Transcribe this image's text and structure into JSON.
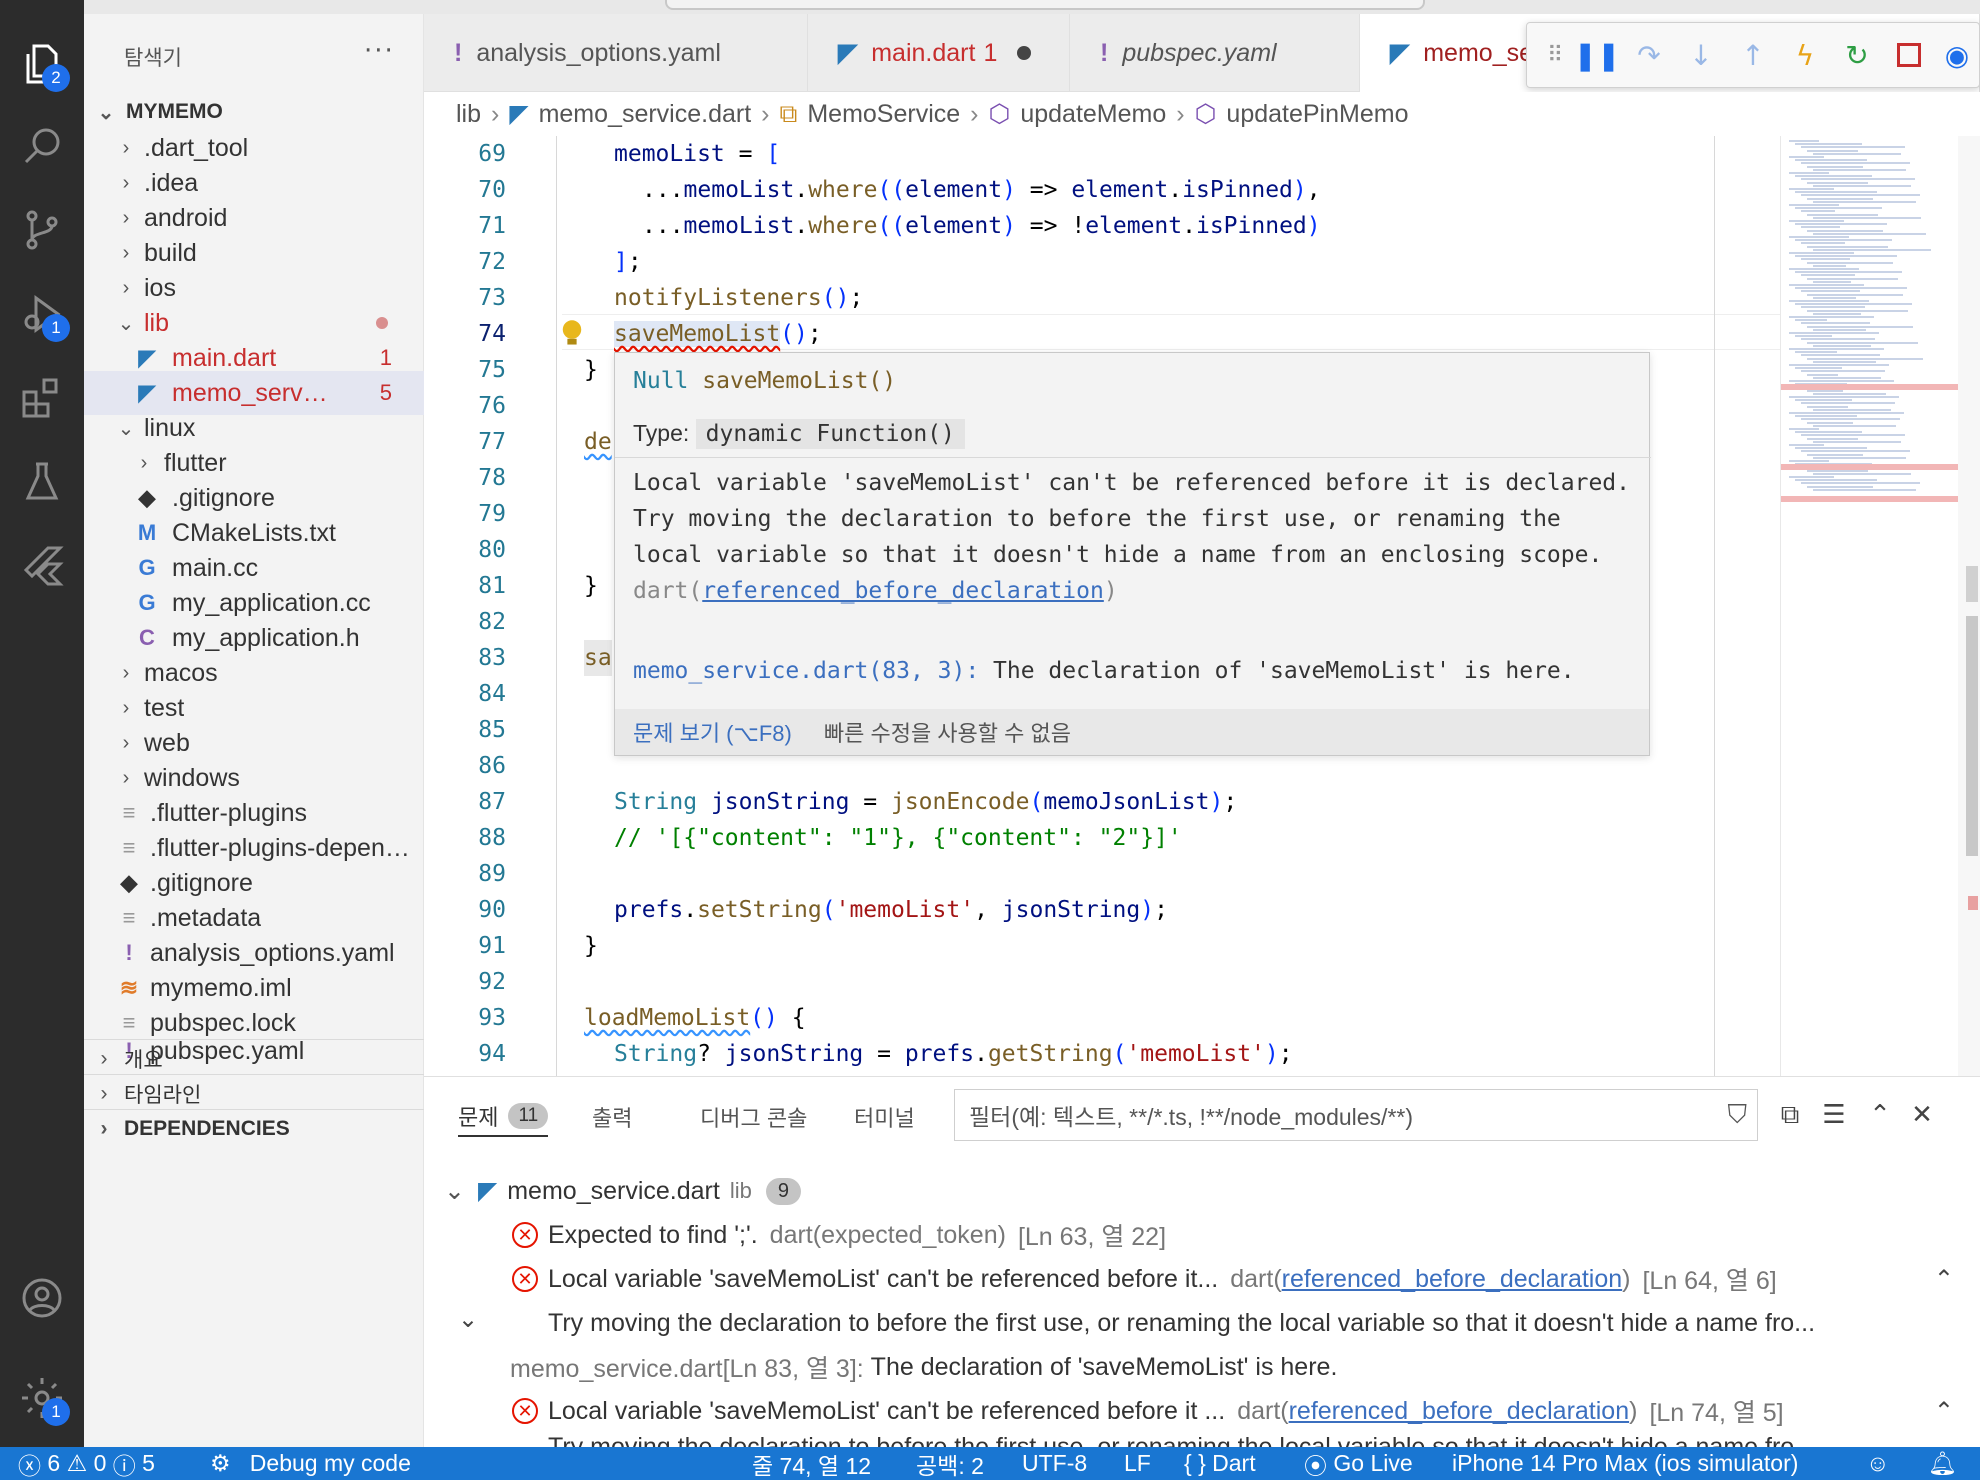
{
  "activity_bar": {
    "explorer_badge": "2",
    "debug_badge": "1",
    "settings_badge": "1"
  },
  "sidebar": {
    "title": "탐색기",
    "more": "···",
    "root": "MYMEMO",
    "items": [
      {
        "label": ".dart_tool"
      },
      {
        "label": ".idea"
      },
      {
        "label": "android"
      },
      {
        "label": "build"
      },
      {
        "label": "ios"
      },
      {
        "label": "lib"
      },
      {
        "label": "main.dart",
        "count": "1"
      },
      {
        "label": "memo_service.dart",
        "count": "5"
      },
      {
        "label": "linux"
      },
      {
        "label": "flutter"
      },
      {
        "label": ".gitignore"
      },
      {
        "label": "CMakeLists.txt"
      },
      {
        "label": "main.cc"
      },
      {
        "label": "my_application.cc"
      },
      {
        "label": "my_application.h"
      },
      {
        "label": "macos"
      },
      {
        "label": "test"
      },
      {
        "label": "web"
      },
      {
        "label": "windows"
      },
      {
        "label": ".flutter-plugins"
      },
      {
        "label": ".flutter-plugins-dependencies"
      },
      {
        "label": ".gitignore"
      },
      {
        "label": ".metadata"
      },
      {
        "label": "analysis_options.yaml"
      },
      {
        "label": "mymemo.iml"
      },
      {
        "label": "pubspec.lock"
      },
      {
        "label": "pubspec.yaml"
      }
    ],
    "sections": [
      {
        "label": "개요"
      },
      {
        "label": "타임라인"
      },
      {
        "label": "DEPENDENCIES"
      }
    ]
  },
  "tabs": [
    {
      "label": "analysis_options.yaml"
    },
    {
      "label": "main.dart",
      "badge": "1"
    },
    {
      "label": "pubspec.yaml"
    },
    {
      "label": "memo_service.dart"
    }
  ],
  "breadcrumb": [
    "lib",
    "memo_service.dart",
    "MemoService",
    "updateMemo",
    "updatePinMemo"
  ],
  "editor": {
    "line_numbers": [
      "69",
      "70",
      "71",
      "72",
      "73",
      "74",
      "75",
      "76",
      "77",
      "78",
      "79",
      "80",
      "81",
      "82",
      "83",
      "84",
      "85",
      "86",
      "87",
      "88",
      "89",
      "90",
      "91",
      "92",
      "93",
      "94"
    ],
    "current_line": "74",
    "tokens": {
      "memoList": "memoList",
      "where": "where",
      "element": "element",
      "isPinned": "isPinned",
      "notifyListeners": "notifyListeners",
      "saveMemoList": "saveMemoList",
      "String": "String",
      "jsonString": "jsonString",
      "jsonEncode": "jsonEncode",
      "memoJsonList": "memoJsonList",
      "comment88": "// '[{\"content\": \"1\"}, {\"content\": \"2\"}]'",
      "prefs": "prefs",
      "setString": "setString",
      "str_memoList": "'memoList'",
      "loadMemoList": "loadMemoList",
      "getString": "getString",
      "de": "de",
      "sa": "sa"
    }
  },
  "hover": {
    "signature_type": "Null",
    "signature_name": "saveMemoList()",
    "type_label": "Type:",
    "type_value": "dynamic Function()",
    "message": "Local variable 'saveMemoList' can't be referenced before it is declared.\nTry moving the declaration to before the first use, or renaming the local variable so that it doesn't hide a name from an enclosing scope.",
    "source_prefix": "dart(",
    "source_code": "referenced_before_declaration",
    "source_suffix": ")",
    "related_loc": "memo_service.dart(83, 3):",
    "related_msg": "The declaration of 'saveMemoList' is here.",
    "action_view": "문제 보기 (⌥F8)",
    "action_fix": "빠른 수정을 사용할 수 없음"
  },
  "panel": {
    "tabs": [
      {
        "label": "문제",
        "badge": "11"
      },
      {
        "label": "출력"
      },
      {
        "label": "디버그 콘솔"
      },
      {
        "label": "터미널"
      }
    ],
    "filter_placeholder": "필터(예: 텍스트, **/*.ts, !**/node_modules/**)",
    "group": {
      "file": "memo_service.dart",
      "folder": "lib",
      "count": "9"
    },
    "problems": [
      {
        "message": "Expected to find ';'.",
        "source": "dart(expected_token)",
        "pos": "[Ln 63, 열 22]"
      },
      {
        "message": "Local variable 'saveMemoList' can't be referenced before it...",
        "src_pre": "dart(",
        "src_code": "referenced_before_declaration",
        "src_post": ")",
        "pos": "[Ln 64, 열 6]",
        "detail": "Try moving the declaration to before the first use, or renaming the local variable so that it doesn't hide a name fro...",
        "related": "memo_service.dart[Ln 83, 열 3]:",
        "related_msg": "The declaration of 'saveMemoList' is here."
      },
      {
        "message": "Local variable 'saveMemoList' can't be referenced before it ...",
        "src_pre": "dart(",
        "src_code": "referenced_before_declaration",
        "src_post": ")",
        "pos": "[Ln 74, 열 5]",
        "detail": "Try moving the declaration to before the first use, or renaming the local variable so that it doesn't hide a name fro..."
      }
    ]
  },
  "statusbar": {
    "errors": "6",
    "warnings": "0",
    "infos": "5",
    "debug": "Debug my code",
    "position": "줄 74, 열 12",
    "spaces": "공백: 2",
    "encoding": "UTF-8",
    "eol": "LF",
    "language": "Dart",
    "golive": "Go Live",
    "device": "iPhone 14 Pro Max (ios simulator)"
  },
  "colors": {
    "status_bg": "#1976d2",
    "error": "#e51400",
    "link": "#3b6fbf"
  }
}
